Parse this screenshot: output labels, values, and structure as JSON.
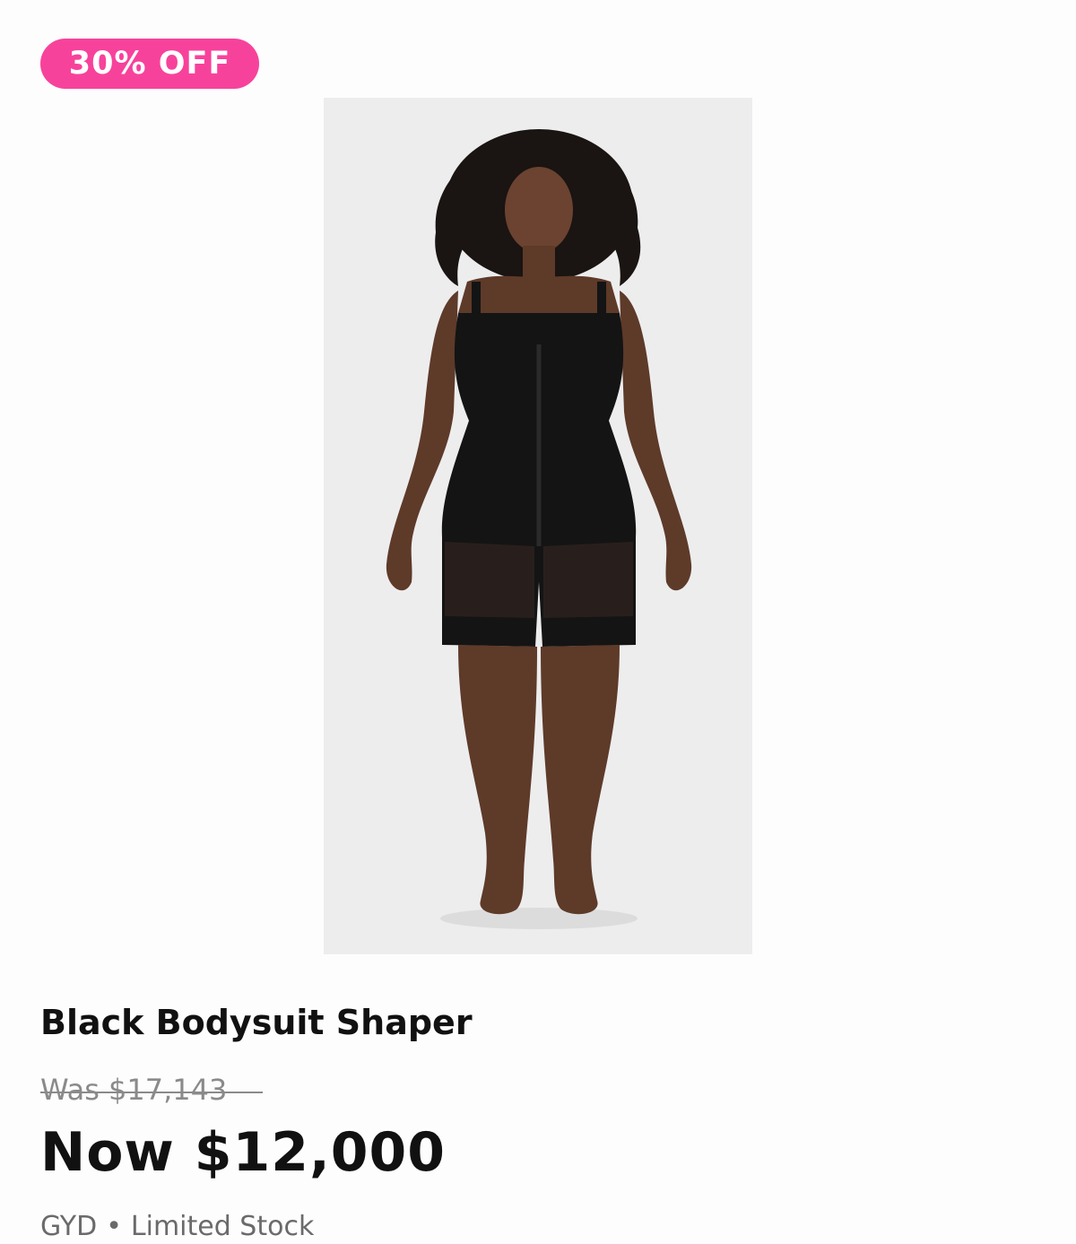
{
  "badge": {
    "label": "30% OFF",
    "color": "#f7429b"
  },
  "product": {
    "title": "Black Bodysuit Shaper",
    "was_price": "Was $17,143",
    "now_price": "Now $12,000",
    "currency": "GYD",
    "separator": "•",
    "stock_status": "Limited Stock"
  },
  "colors": {
    "price_text": "#111111",
    "muted_text": "#6a6a6a",
    "photo_bg": "#ededee"
  }
}
